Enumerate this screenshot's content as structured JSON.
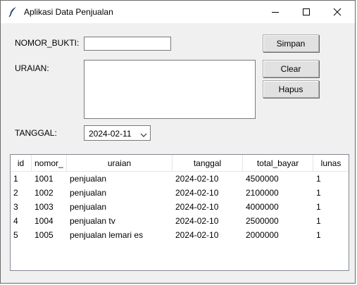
{
  "window": {
    "title": "Aplikasi Data Penjualan",
    "icon": "feather-icon"
  },
  "form": {
    "nomor_bukti_label": "NOMOR_BUKTI:",
    "nomor_bukti_value": "",
    "uraian_label": "URAIAN:",
    "uraian_value": "",
    "tanggal_label": "TANGGAL:",
    "tanggal_value": "2024-02-11"
  },
  "buttons": {
    "simpan": "Simpan",
    "clear": "Clear",
    "hapus": "Hapus"
  },
  "table": {
    "columns": [
      "id",
      "nomor_",
      "uraian",
      "tanggal",
      "total_bayar",
      "lunas"
    ],
    "rows": [
      [
        "1",
        "1001",
        "penjualan",
        "2024-02-10",
        "4500000",
        "1"
      ],
      [
        "2",
        "1002",
        "penjualan",
        "2024-02-10",
        "2100000",
        "1"
      ],
      [
        "3",
        "1003",
        "penjualan",
        "2024-02-10",
        "4000000",
        "1"
      ],
      [
        "4",
        "1004",
        "penjualan tv",
        "2024-02-10",
        "2500000",
        "1"
      ],
      [
        "5",
        "1005",
        "penjualan lemari es",
        "2024-02-10",
        "2000000",
        "1"
      ]
    ]
  }
}
